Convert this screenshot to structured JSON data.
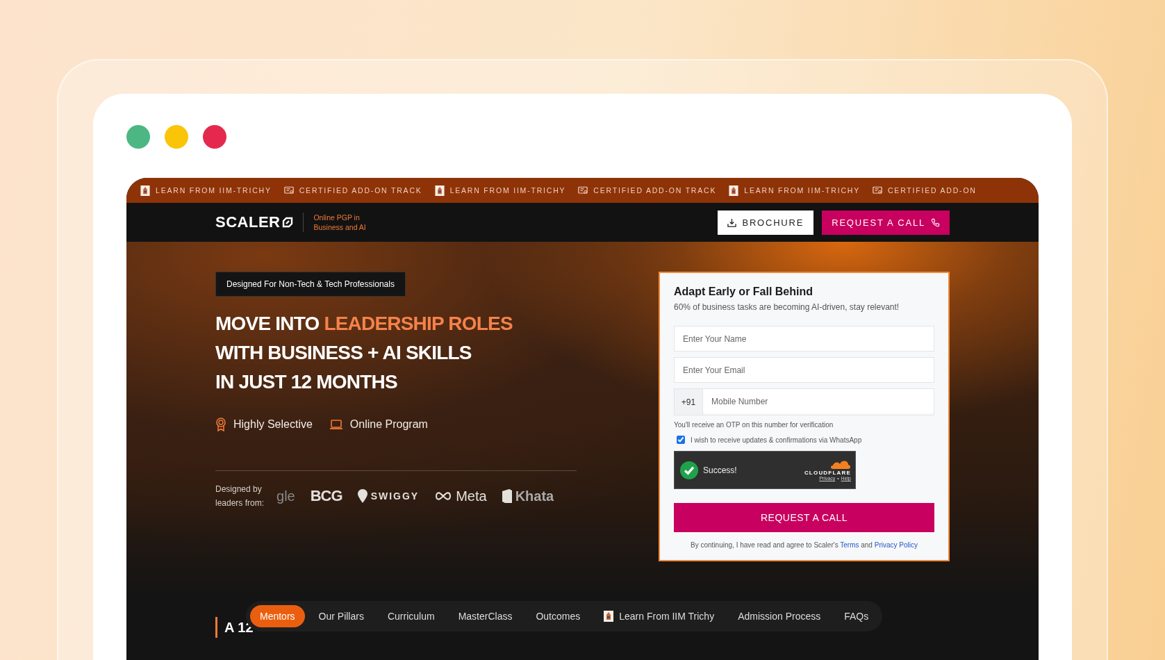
{
  "window_controls": [
    {
      "color": "#4cb782"
    },
    {
      "color": "#fac409"
    },
    {
      "color": "#e5294e"
    }
  ],
  "ticker": [
    {
      "kind": "iim",
      "text": "LEARN FROM IIM-TRICHY"
    },
    {
      "kind": "certificate",
      "text": "CERTIFIED ADD-ON TRACK"
    },
    {
      "kind": "iim",
      "text": "LEARN FROM IIM-TRICHY"
    },
    {
      "kind": "certificate",
      "text": "CERTIFIED ADD-ON TRACK"
    },
    {
      "kind": "iim",
      "text": "LEARN FROM IIM-TRICHY"
    },
    {
      "kind": "certificate",
      "text": "CERTIFIED ADD-ON"
    }
  ],
  "header": {
    "logo": "SCALER",
    "tagline": [
      "Online PGP in",
      "Business and AI"
    ],
    "brochure": "BROCHURE",
    "request": "REQUEST A CALL"
  },
  "hero": {
    "badge": "Designed For Non-Tech & Tech Professionals",
    "headline": [
      [
        {
          "text": "MOVE INTO ",
          "accent": false
        },
        {
          "text": "LEADERSHIP ROLES",
          "accent": true
        }
      ],
      [
        {
          "text": "WITH BUSINESS + AI SKILLS",
          "accent": false
        }
      ],
      [
        {
          "text": "IN JUST 12 MONTHS",
          "accent": false
        }
      ]
    ],
    "features": [
      {
        "kind": "award",
        "text": "Highly Selective"
      },
      {
        "kind": "laptop",
        "text": "Online Program"
      }
    ],
    "leaders_label": [
      "Designed by",
      "leaders from:"
    ],
    "logos": [
      {
        "kind": "plain",
        "text": "gle"
      },
      {
        "kind": "bcg",
        "text": "BCG"
      },
      {
        "kind": "swiggy",
        "text": "SWIGGY"
      },
      {
        "kind": "meta",
        "text": "Meta"
      },
      {
        "kind": "khata",
        "text": "Khata"
      }
    ]
  },
  "form": {
    "title": "Adapt Early or Fall Behind",
    "subtitle": "60% of business tasks are becoming AI-driven, stay relevant!",
    "name_placeholder": "Enter Your Name",
    "email_placeholder": "Enter Your Email",
    "country_code": "+91",
    "mobile_placeholder": "Mobile Number",
    "otp_note": "You'll receive an OTP on this number for verification",
    "whatsapp": {
      "label": "I wish to receive updates & confirmations via WhatsApp",
      "checked": true
    },
    "captcha": {
      "status": "Success!",
      "brand": "CLOUDFLARE",
      "privacy": "Privacy",
      "separator": "•",
      "help": "Help"
    },
    "submit": "REQUEST A CALL",
    "consent": {
      "before": "By continuing, I have read and agree to Scaler's ",
      "terms": "Terms",
      "middle": " and ",
      "privacy": "Privacy Policy"
    }
  },
  "section_heading": "A 12",
  "section_nav": [
    {
      "text": "Mentors",
      "selected": true,
      "kind": "plain"
    },
    {
      "text": "Our Pillars",
      "selected": false,
      "kind": "plain"
    },
    {
      "text": "Curriculum",
      "selected": false,
      "kind": "plain"
    },
    {
      "text": "MasterClass",
      "selected": false,
      "kind": "plain"
    },
    {
      "text": "Outcomes",
      "selected": false,
      "kind": "plain"
    },
    {
      "text": "Learn From IIM Trichy",
      "selected": false,
      "kind": "iim"
    },
    {
      "text": "Admission Process",
      "selected": false,
      "kind": "plain"
    },
    {
      "text": "FAQs",
      "selected": false,
      "kind": "plain"
    }
  ]
}
